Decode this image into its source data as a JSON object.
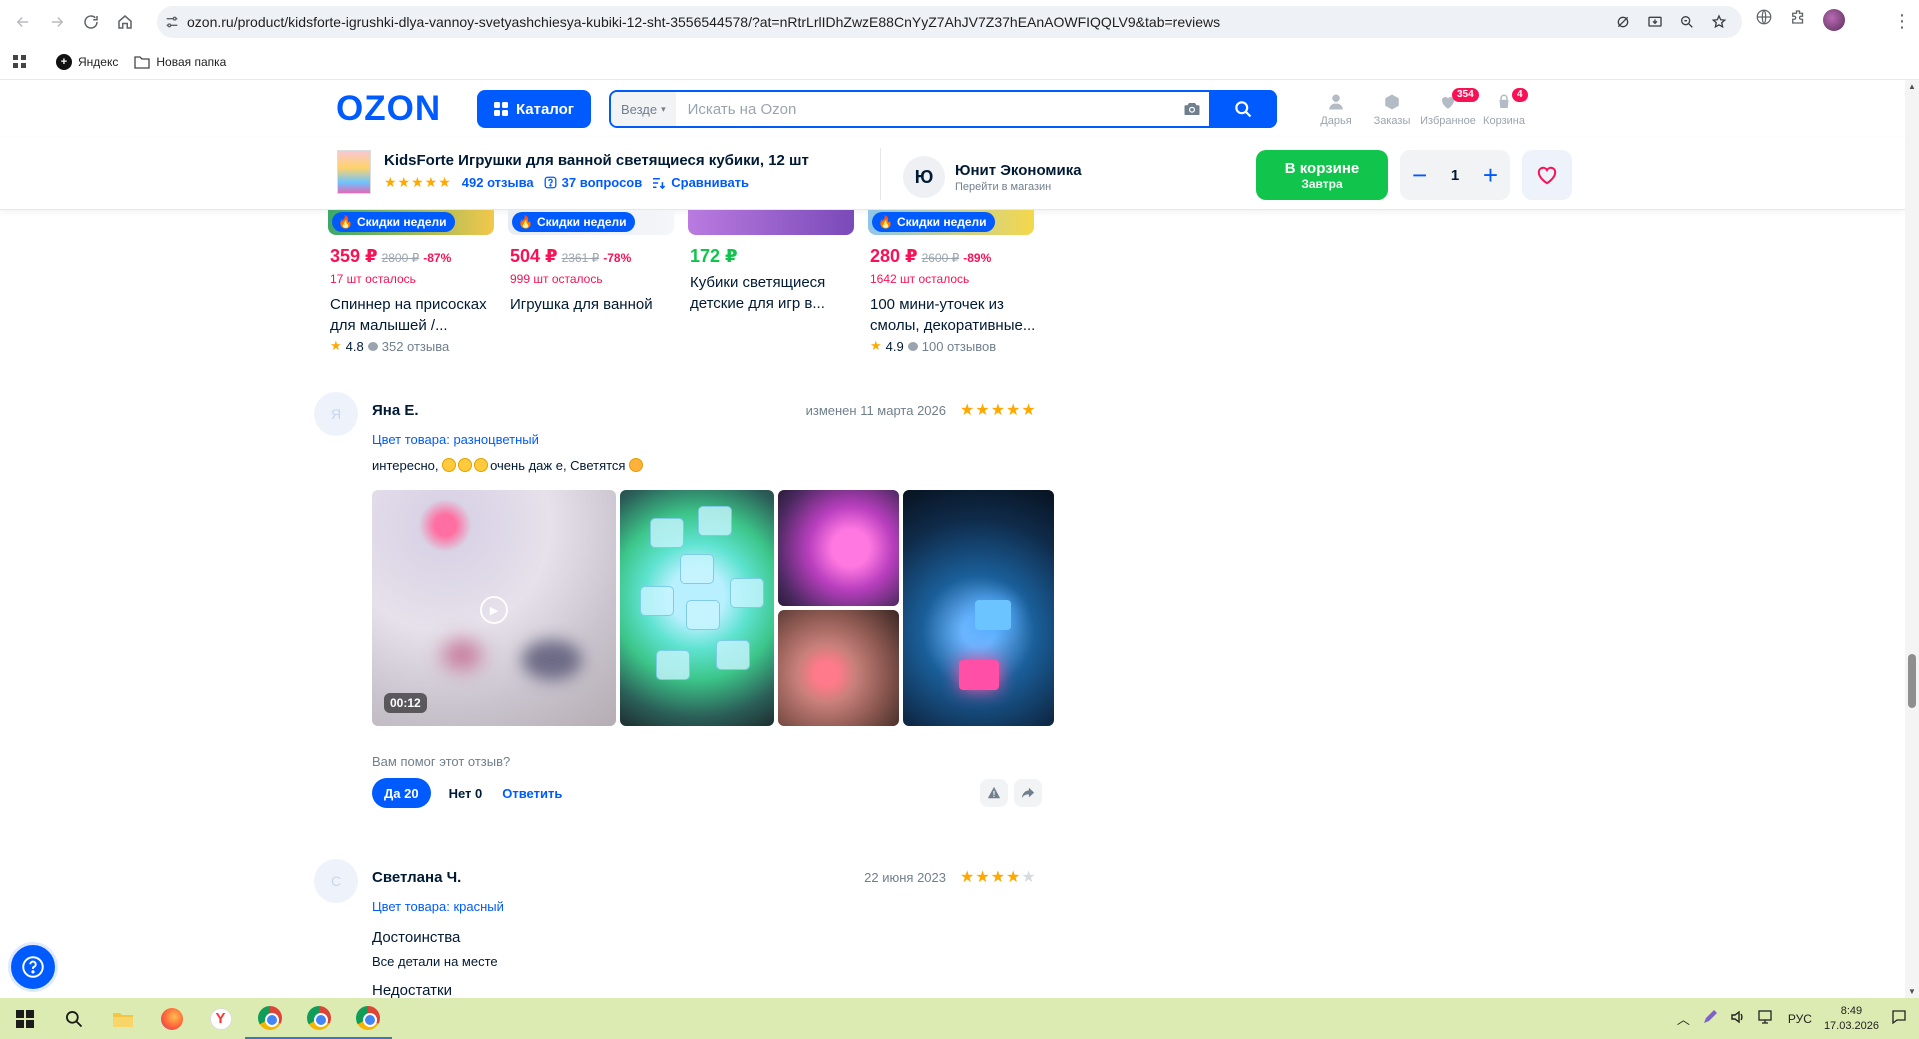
{
  "browser": {
    "url": "ozon.ru/product/kidsforte-igrushki-dlya-vannoy-svetyashchiesya-kubiki-12-sht-3556544578/?at=nRtrLrlIDhZwzE88CnYyZ7AhJV7Z37hEAnAOWFIQQLV9&tab=reviews",
    "bookmarks": [
      {
        "label": "Яндекс",
        "icon": "yandex-icon"
      },
      {
        "label": "Новая папка",
        "icon": "folder-icon"
      }
    ]
  },
  "header": {
    "logo": "OZON",
    "catalog_label": "Каталог",
    "search_scope": "Везде",
    "search_placeholder": "Искать на Ozon",
    "icons": [
      {
        "label": "Дарья",
        "icon": "profile-icon",
        "badge": ""
      },
      {
        "label": "Заказы",
        "icon": "orders-icon",
        "badge": ""
      },
      {
        "label": "Избранное",
        "icon": "heart-icon",
        "badge": "354"
      },
      {
        "label": "Корзина",
        "icon": "cart-icon",
        "badge": "4"
      }
    ]
  },
  "product_bar": {
    "title": "KidsForte Игрушки для ванной светящиеся кубики, 12 шт",
    "reviews_link": "492 отзыва",
    "questions_link": "37 вопросов",
    "compare_link": "Сравнивать",
    "seller_initial": "Ю",
    "seller_name": "Юнит Экономика",
    "seller_sub": "Перейти в магазин",
    "cart_label": "В корзине",
    "cart_sub": "Завтра",
    "qty": "1",
    "accent_color": "#005bff",
    "cart_color": "#10c44c"
  },
  "cards": [
    {
      "badge": "Скидки недели",
      "price": "359 ₽",
      "old": "2800 ₽",
      "disc": "-87%",
      "left": "17 шт осталось",
      "name_line1": "Спиннер на присосках",
      "name_line2": "для малышей /...",
      "rating": "4.8",
      "reviews": "352 отзыва"
    },
    {
      "badge": "Скидки недели",
      "price": "504 ₽",
      "old": "2361 ₽",
      "disc": "-78%",
      "left": "999 шт осталось",
      "name_line1": "Игрушка для ванной",
      "name_line2": "",
      "rating": "",
      "reviews": ""
    },
    {
      "badge": "",
      "price": "172 ₽",
      "old": "",
      "disc": "",
      "left": "",
      "name_line1": "Кубики светящиеся",
      "name_line2": "детские для игр в...",
      "rating": "",
      "reviews": ""
    },
    {
      "badge": "Скидки недели",
      "price": "280 ₽",
      "old": "2600 ₽",
      "disc": "-89%",
      "left": "1642 шт осталось",
      "name_line1": "100 мини-уточек из",
      "name_line2": "смолы, декоративные...",
      "rating": "4.9",
      "reviews": "100 отзывов"
    }
  ],
  "reviews": [
    {
      "initial": "Я",
      "author": "Яна Е.",
      "date": "изменен 11 марта 2026",
      "rating": 5,
      "color_label": "Цвет товара: разноцветный",
      "text_a": "интересно, ",
      "text_b": "очень даж е, Светятся ",
      "video_duration": "00:12",
      "helpful_question": "Вам помог этот отзыв?",
      "yes_label": "Да 20",
      "no_label": "Нет 0",
      "reply_label": "Ответить"
    },
    {
      "initial": "С",
      "author": "Светлана Ч.",
      "date": "22 июня 2023",
      "rating": 4,
      "color_label": "Цвет товара: красный",
      "pros_title": "Достоинства",
      "pros_text": "Все детали на месте",
      "cons_title": "Недостатки"
    }
  ],
  "taskbar": {
    "lang": "РУС",
    "time": "8:49",
    "date": "17.03.2026"
  }
}
